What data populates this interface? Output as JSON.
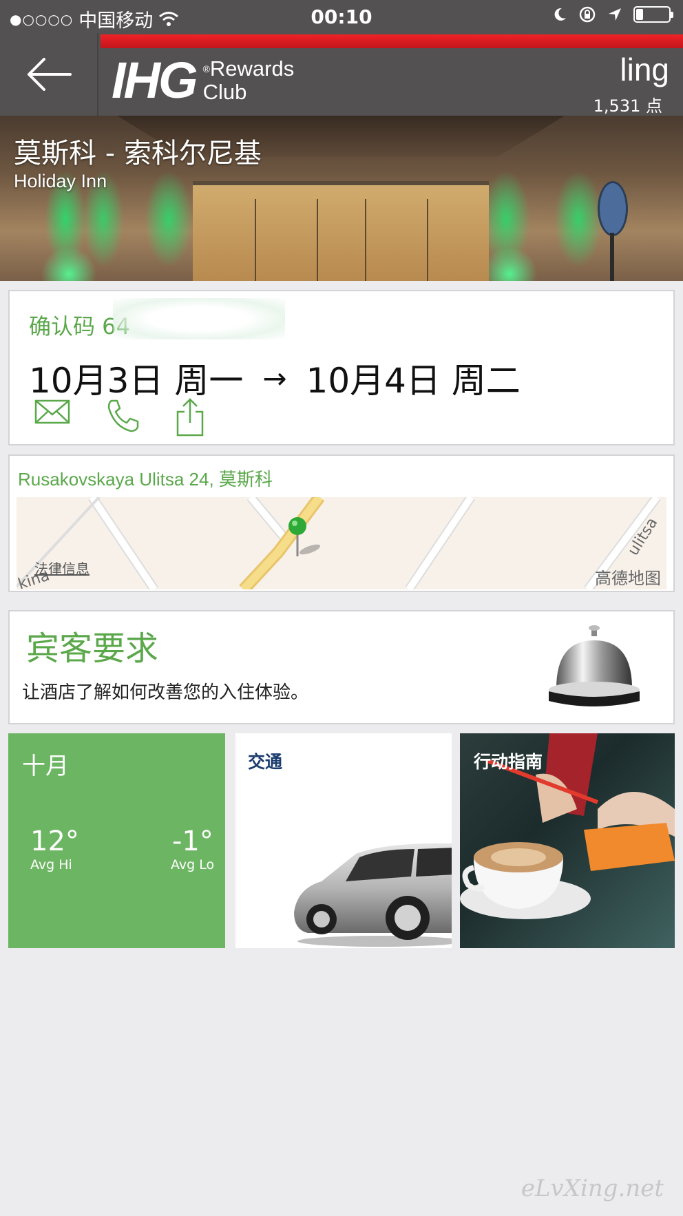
{
  "status_bar": {
    "signal": "●○○○○",
    "carrier": "中国移动",
    "time": "00:10"
  },
  "header": {
    "logo_text": "IHG",
    "logo_sub1": "Rewards",
    "logo_sub2": "Club",
    "user_name": "ling",
    "points": "1,531 点",
    "accent_color": "#e31e24"
  },
  "hotel": {
    "name": "莫斯科 - 索科尔尼基",
    "brand": "Holiday Inn"
  },
  "booking": {
    "confirmation_label": "确认码 64",
    "check_in": "10月3日 周一",
    "arrow": "→",
    "check_out": "10月4日 周二",
    "actions": [
      "mail-icon",
      "phone-icon",
      "share-icon"
    ]
  },
  "address": {
    "text": "Rusakovskaya Ulitsa 24, 莫斯科",
    "map_legal": "法律信息",
    "map_provider": "高德地图",
    "street_left": "kina",
    "street_right": "ulitsa"
  },
  "guest_request": {
    "title": "宾客要求",
    "description": "让酒店了解如何改善您的入住体验。"
  },
  "tiles": {
    "weather": {
      "month": "十月",
      "avg_hi": "12°",
      "avg_hi_label": "Avg Hi",
      "avg_lo": "-1°",
      "avg_lo_label": "Avg Lo",
      "color": "#6cb562"
    },
    "transit": {
      "label": "交通"
    },
    "guide": {
      "label": "行动指南"
    }
  },
  "watermark": "eLvXing.net",
  "brand_green": "#5aa84a"
}
